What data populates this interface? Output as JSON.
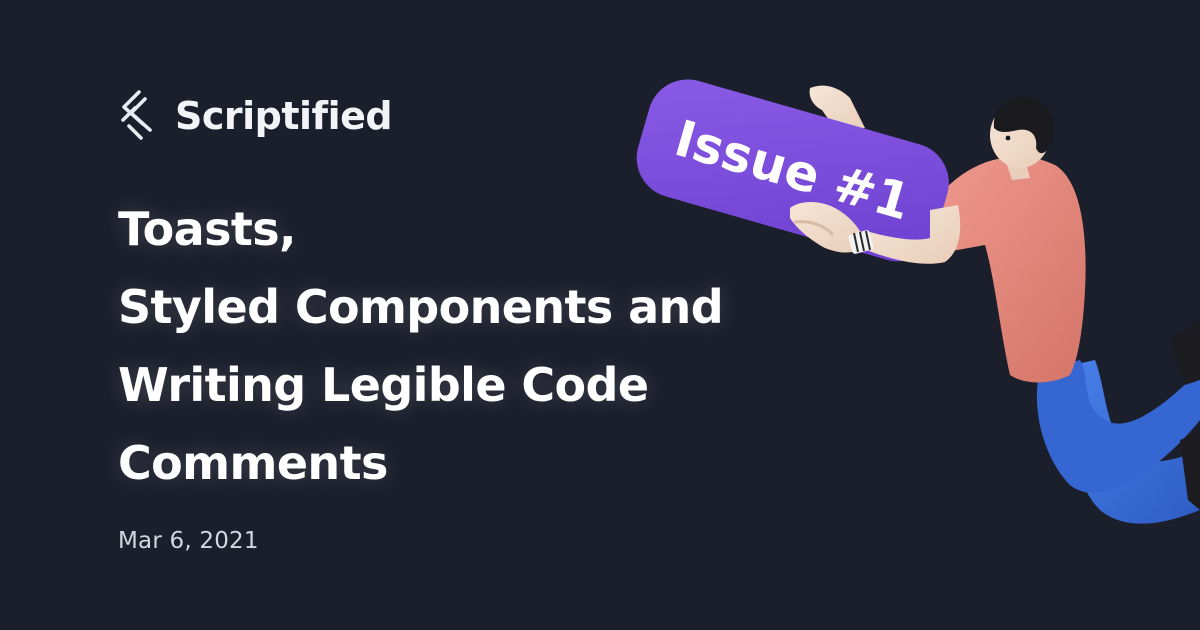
{
  "brand": {
    "name": "Scriptified",
    "logo_icon": "scriptified-s-logo-icon"
  },
  "article": {
    "title_lines": [
      "Toasts,",
      "Styled Components and",
      "Writing Legible Code",
      "Comments"
    ],
    "date": "Mar 6, 2021"
  },
  "illustration": {
    "sign_text": "Issue #1",
    "sign_color": "#7c4ddb",
    "shirt_color": "#e58a80",
    "pants_color": "#3a6fd8",
    "skin_color": "#f2dccb",
    "hair_color": "#1a1a1f"
  },
  "colors": {
    "background": "#1b1e2b",
    "text": "#ffffff",
    "muted_text": "#d4d7e0"
  }
}
